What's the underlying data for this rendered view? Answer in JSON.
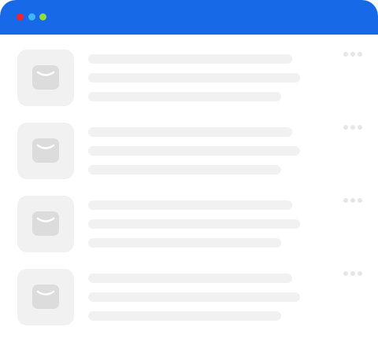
{
  "colors": {
    "titlebar": "#1769e8",
    "window_dots": [
      "#f5222d",
      "#3fb8f3",
      "#8ede3c"
    ],
    "thumbnail_bg": "#f1f1f1",
    "thumbnail_icon": "#dcdcdc",
    "skeleton_line": "#f1f1f1",
    "more_dots": "#e6e6e6"
  },
  "titlebar": {
    "window_controls": [
      "close-dot",
      "minimize-dot",
      "maximize-dot"
    ]
  },
  "list": {
    "items": [
      {
        "icon": "envelope-icon",
        "menu_icon": "more-options-icon",
        "skeleton_lines": 3
      },
      {
        "icon": "envelope-icon",
        "menu_icon": "more-options-icon",
        "skeleton_lines": 3
      },
      {
        "icon": "envelope-icon",
        "menu_icon": "more-options-icon",
        "skeleton_lines": 3
      },
      {
        "icon": "envelope-icon",
        "menu_icon": "more-options-icon",
        "skeleton_lines": 3
      }
    ]
  }
}
